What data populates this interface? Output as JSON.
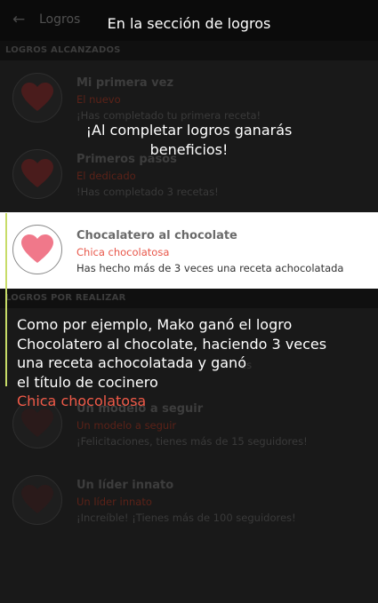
{
  "appbar": {
    "back_icon": "arrow-left-icon",
    "title": "Logros"
  },
  "sections": {
    "achieved_header": "LOGROS ALCANZADOS",
    "pending_header": "LOGROS POR REALIZAR"
  },
  "achieved": [
    {
      "title": "Mi primera vez",
      "rank": "El nuevo",
      "desc": "¡Has completado tu primera receta!",
      "icon": "heart-icon"
    },
    {
      "title": "Primeros pasos",
      "rank": "El dedicado",
      "desc": "!Has completado 3 recetas!",
      "icon": "heart-icon"
    },
    {
      "title": "Chocalatero al chocolate",
      "rank": "Chica chocolatosa",
      "desc": "Has hecho más de 3 veces una receta achocolatada",
      "icon": "heart-icon"
    }
  ],
  "pending": [
    {
      "title": "Un modelo a seguir",
      "rank": "Un modelo a seguir",
      "desc": "¡Felicitaciones, tienes más de 15 seguidores!",
      "icon": "heart-icon"
    },
    {
      "title": "Un líder innato",
      "rank": "Un líder innato",
      "desc": "¡Increíble! ¡Tienes más de 100 seguidores!",
      "icon": "heart-icon"
    }
  ],
  "partial_hidden_text": "es",
  "overlay": {
    "top_title": "En la sección de logros",
    "message1": "¡Al completar logros ganarás beneficios!",
    "message2_lines": [
      "Como por ejemplo, Mako ganó el logro",
      "Chocolatero al chocolate, haciendo 3 veces",
      "una receta achocolatada y ganó",
      "el título de cocinero"
    ],
    "message2_accent": "Chica chocolatosa"
  },
  "colors": {
    "heart_dim": "#4a1c1c",
    "heart_bright": "#f0788a",
    "accent": "#f05a48",
    "guide_line": "#c7dc68"
  }
}
